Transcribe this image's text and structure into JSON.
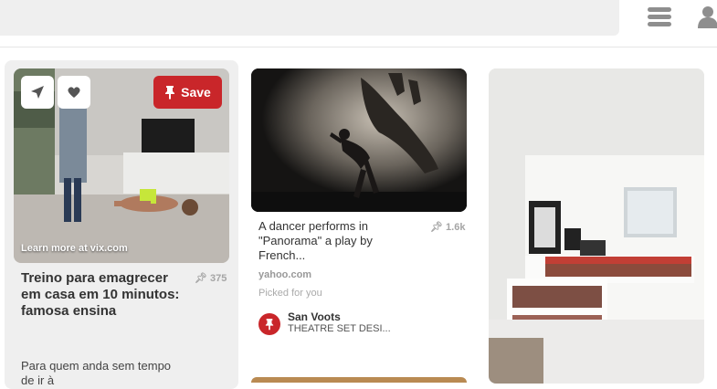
{
  "header": {
    "menu_icon": "hamburger-menu-icon",
    "profile_icon": "user-profile-icon"
  },
  "pins": [
    {
      "save_label": "Save",
      "source_overlay": "Learn more at vix.com",
      "title": "Treino para emagrecer em casa em 10 minutos: famosa ensina",
      "count": "375",
      "description": "Para quem anda sem tempo de ir à"
    },
    {
      "title": "A dancer performs in \"Panorama\" a play by French...",
      "count": "1.6k",
      "domain": "yahoo.com",
      "picked": "Picked for you",
      "user": "San Voots",
      "board": "THEATRE SET DESI..."
    }
  ],
  "colors": {
    "accent": "#c9262a",
    "search_bg": "#efefef",
    "card_hover_bg": "#efefef"
  }
}
